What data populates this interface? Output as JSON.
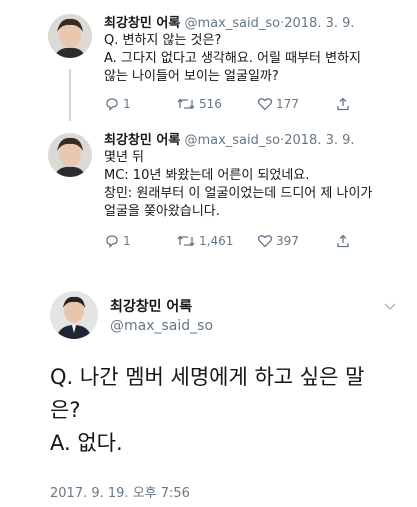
{
  "thread": [
    {
      "name": "최강창민 어록",
      "handle": "@max_said_so",
      "sep": "·",
      "date": "2018. 3. 9.",
      "lines": [
        "Q. 변하지 않는 것은?",
        "A. 그다지 없다고 생각해요. 어릴 때부터 변하지",
        "않는 나이들어 보이는 얼굴일까?"
      ],
      "reply_count": "1",
      "retweet_count": "516",
      "like_count": "177"
    },
    {
      "name": "최강창민 어록",
      "handle": "@max_said_so",
      "sep": "·",
      "date": "2018. 3. 9.",
      "lines": [
        "몇년 뒤",
        "MC: 10년 봐왔는데 어른이 되었네요.",
        "창민: 원래부터 이 얼굴이었는데 드디어 제 나이가",
        "얼굴을 쫒아왔습니다."
      ],
      "reply_count": "1",
      "retweet_count": "1,461",
      "like_count": "397"
    }
  ],
  "main_tweet": {
    "name": "최강창민 어록",
    "handle": "@max_said_so",
    "lines": [
      "Q. 나간 멤버 세명에게 하고 싶은 말",
      "은?",
      "A. 없다."
    ],
    "timestamp": "2017. 9. 19. 오후 7:56"
  },
  "icons": [
    "chevron-down-icon",
    "reply-icon",
    "retweet-icon",
    "like-icon",
    "share-icon"
  ],
  "colors": {
    "text": "#14171a",
    "secondary": "#657786",
    "line": "#ccd6dd"
  }
}
